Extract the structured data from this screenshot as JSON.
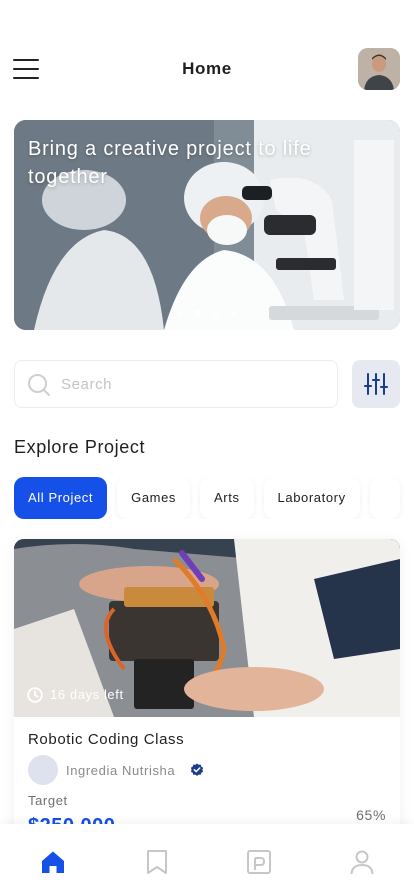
{
  "header": {
    "title": "Home",
    "menu_icon": "hamburger-menu-icon",
    "avatar": "user-avatar"
  },
  "hero": {
    "title": "Bring a creative project to life together",
    "slides": 4,
    "active_slide": 1
  },
  "search": {
    "placeholder": "Search",
    "value": "",
    "icon": "search-icon",
    "filter_icon": "sliders-filter-icon"
  },
  "explore": {
    "title": "Explore Project",
    "categories": [
      {
        "label": "All Project",
        "active": true
      },
      {
        "label": "Games",
        "active": false
      },
      {
        "label": "Arts",
        "active": false
      },
      {
        "label": "Laboratory",
        "active": false
      }
    ]
  },
  "project_card": {
    "days_left": "16 days left",
    "title": "Robotic Coding Class",
    "creator": "Ingredia Nutrisha",
    "target_label": "Target",
    "target_value": "$250.000",
    "progress": "65%"
  },
  "bottom_nav": {
    "items": [
      {
        "name": "home",
        "icon": "home-icon",
        "active": true
      },
      {
        "name": "saved",
        "icon": "bookmark-icon",
        "active": false
      },
      {
        "name": "wallet",
        "icon": "wallet-icon",
        "active": false
      },
      {
        "name": "profile",
        "icon": "user-icon",
        "active": false
      }
    ]
  },
  "colors": {
    "accent": "#1550e8",
    "filter_bg": "#e6e9ef",
    "text_primary": "#1f1f1f",
    "text_secondary": "#8a8a8a",
    "nav_inactive": "#c7c7c7"
  }
}
